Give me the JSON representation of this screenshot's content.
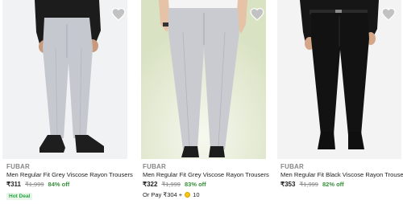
{
  "products": [
    {
      "brand": "FUBAR",
      "title": "Men Regular Fit Grey Viscose Rayon Trousers",
      "price": "₹311",
      "mrp": "₹1,999",
      "discount": "84% off",
      "badge": "Hot Deal",
      "image": "light-grey-trousers-photo",
      "background": "#f1f2f4"
    },
    {
      "brand": "FUBAR",
      "title": "Men Regular Fit Grey Viscose Rayon Trousers",
      "price": "₹322",
      "mrp": "₹1,999",
      "discount": "83% off",
      "alt_pay_prefix": "Or Pay ₹304 +",
      "alt_pay_coins": "10",
      "image": "light-grey-trousers-photo",
      "background": "#e7ecd9"
    },
    {
      "brand": "FUBAR",
      "title": "Men Regular Fit Black Viscose Rayon Trousers",
      "price": "₹353",
      "mrp": "₹1,999",
      "discount": "82% off",
      "image": "black-trousers-photo",
      "background": "#f3f3f3"
    }
  ],
  "colors": {
    "discount_green": "#388e3c",
    "muted_text": "#878787",
    "deal_badge": "#26a541"
  }
}
